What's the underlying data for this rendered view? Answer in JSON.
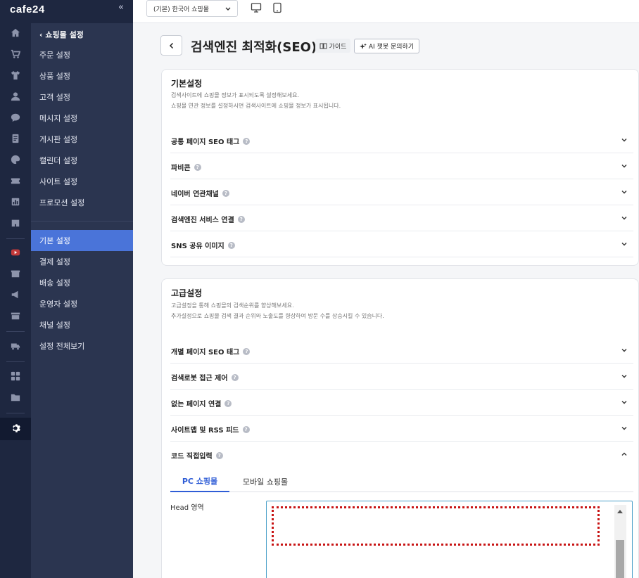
{
  "brand": {
    "logo": "cafe24",
    "collapse": "«"
  },
  "rail": {
    "icons": [
      "home-icon",
      "cart-icon",
      "shirt-icon",
      "person-icon",
      "chat-icon",
      "board-icon",
      "palette-icon",
      "coupon-icon",
      "chart-icon",
      "store-icon",
      "youtube-icon",
      "box-icon",
      "megaphone-icon",
      "shop-icon",
      "truck-icon",
      "apps-icon",
      "folder-icon",
      "gear-icon"
    ],
    "active": "gear-icon"
  },
  "subnav": {
    "title": "쇼핑몰 설정",
    "group1": [
      "주문 설정",
      "상품 설정",
      "고객 설정",
      "메시지 설정",
      "게시판 설정",
      "캘린더 설정",
      "사이트 설정",
      "프로모션 설정"
    ],
    "group2": [
      "기본 설정",
      "결제 설정",
      "배송 설정",
      "운영자 설정",
      "채널 설정",
      "설정 전체보기"
    ],
    "active": "기본 설정"
  },
  "topbar": {
    "shop_select": "(기본) 한국어 쇼핑몰"
  },
  "page": {
    "title": "검색엔진 최적화(SEO)",
    "guide_label": "가이드",
    "ai_label": "AI 챗봇 문의하기"
  },
  "basic": {
    "title": "기본설정",
    "desc1": "검색사이트에 쇼핑몰 정보가 표시되도록 설정해보세요.",
    "desc2": "쇼핑몰 연관 정보를 설정하시면 검색사이트에 쇼핑몰 정보가 표시됩니다.",
    "rows": [
      "공통 페이지 SEO 태그",
      "파비콘",
      "네이버 연관채널",
      "검색엔진 서비스 연결",
      "SNS 공유 이미지"
    ]
  },
  "advanced": {
    "title": "고급설정",
    "desc1": "고급설정을 통해 쇼핑몰의 검색순위를 향상해보세요.",
    "desc2": "추가설정으로 쇼핑몰 검색 결과 순위와 노출도를 향상하여 방문 수를 상승시킬 수 있습니다.",
    "rows": [
      "개별 페이지 SEO 태그",
      "검색로봇 접근 제어",
      "없는 페이지 연결",
      "사이트맵 및 RSS 피드",
      "코드 직접입력"
    ]
  },
  "code": {
    "tab_pc": "PC 쇼핑몰",
    "tab_mobile": "모바일 쇼핑몰",
    "head_label": "Head 영역",
    "head_value": ""
  },
  "colors": {
    "rail": "#1e2740",
    "subnav": "#2b3550",
    "active": "#4a74d9",
    "tab_active": "#2f5dd6",
    "highlight": "#c81414"
  }
}
